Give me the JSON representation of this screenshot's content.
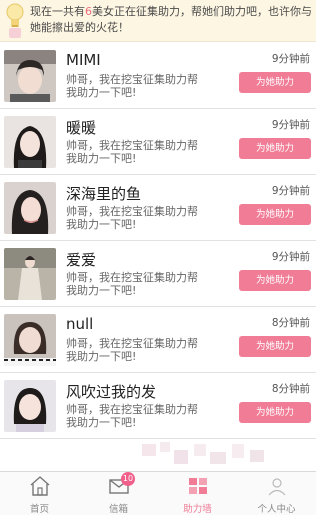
{
  "notice": {
    "part1": "现在一共有",
    "count": "6",
    "part2": "美女正在征集助力，帮她们助力吧，也许你与她能擦出爱的火花！"
  },
  "items": [
    {
      "name": "MIMI",
      "message": "帅哥，我在挖宝征集助力帮我助力一下吧!",
      "time": "9分钟前",
      "button": "为她助力"
    },
    {
      "name": "暖暖",
      "message": "帅哥，我在挖宝征集助力帮我助力一下吧!",
      "time": "9分钟前",
      "button": "为她助力"
    },
    {
      "name": "深海里的鱼",
      "message": "帅哥，我在挖宝征集助力帮我助力一下吧!",
      "time": "9分钟前",
      "button": "为她助力"
    },
    {
      "name": "爱爱",
      "message": "帅哥，我在挖宝征集助力帮我助力一下吧!",
      "time": "9分钟前",
      "button": "为她助力"
    },
    {
      "name": "null",
      "message": "帅哥，我在挖宝征集助力帮我助力一下吧!",
      "time": "8分钟前",
      "button": "为她助力"
    },
    {
      "name": "风吹过我的发",
      "message": "帅哥，我在挖宝征集助力帮我助力一下吧!",
      "time": "8分钟前",
      "button": "为她助力"
    }
  ],
  "tabbar": {
    "tabs": [
      {
        "label": "首页",
        "icon": "home-icon"
      },
      {
        "label": "信箱",
        "icon": "mail-icon",
        "badge": "10"
      },
      {
        "label": "助力墙",
        "icon": "wall-icon",
        "active": true
      },
      {
        "label": "个人中心",
        "icon": "user-icon"
      }
    ]
  },
  "colors": {
    "accent": "#f07c96",
    "notice_bg": "#fdf6e3",
    "highlight": "#f06a7d"
  }
}
